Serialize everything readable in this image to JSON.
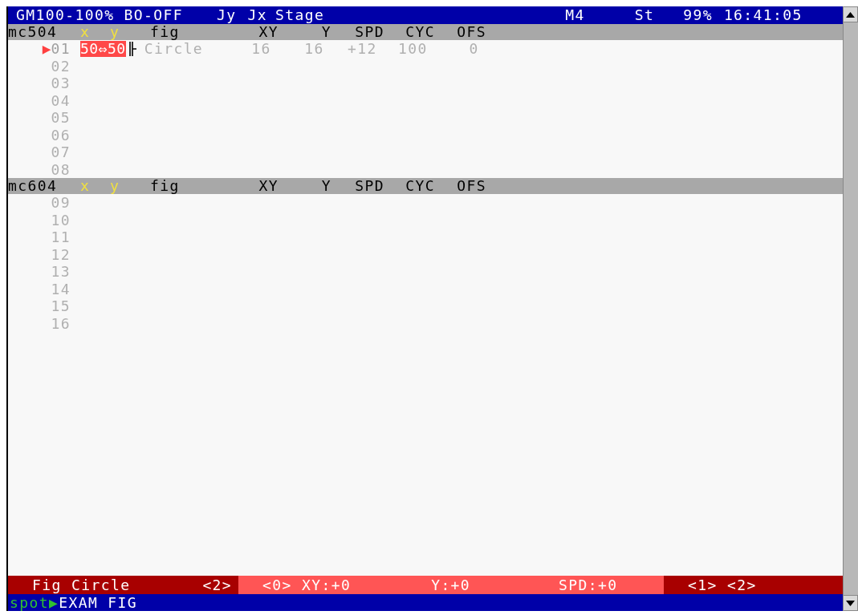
{
  "title_bar": {
    "items": [
      "GM100-100% BO-OFF",
      "Jy",
      "Jx",
      "Stage",
      "M4",
      "St",
      "99%",
      "16:41:05"
    ]
  },
  "panels": [
    {
      "name": "mc504",
      "columns": [
        {
          "label": "x",
          "kind": "coordinate"
        },
        {
          "label": "y",
          "kind": "coordinate"
        },
        {
          "label": "fig",
          "kind": "field"
        },
        {
          "label": "XY",
          "kind": "field"
        },
        {
          "label": "Y",
          "kind": "field"
        },
        {
          "label": "SPD",
          "kind": "field"
        },
        {
          "label": "CYC",
          "kind": "field"
        },
        {
          "label": "OFS",
          "kind": "field"
        }
      ],
      "rows": [
        {
          "number": "01",
          "selected": true,
          "marker": "▶",
          "value": "50⇔50",
          "fig": "Circle",
          "cells": [
            "16",
            "16",
            "+12",
            "100",
            "0"
          ]
        },
        {
          "number": "02",
          "selected": false
        },
        {
          "number": "03",
          "selected": false
        },
        {
          "number": "04",
          "selected": false
        },
        {
          "number": "05",
          "selected": false
        },
        {
          "number": "06",
          "selected": false
        },
        {
          "number": "07",
          "selected": false
        },
        {
          "number": "08",
          "selected": false
        }
      ]
    },
    {
      "name": "mc604",
      "columns": [
        {
          "label": "x",
          "kind": "coordinate"
        },
        {
          "label": "y",
          "kind": "coordinate"
        },
        {
          "label": "fig",
          "kind": "field"
        },
        {
          "label": "XY",
          "kind": "field"
        },
        {
          "label": "Y",
          "kind": "field"
        },
        {
          "label": "SPD",
          "kind": "field"
        },
        {
          "label": "CYC",
          "kind": "field"
        },
        {
          "label": "OFS",
          "kind": "field"
        }
      ],
      "rows": [
        {
          "number": "09",
          "selected": false
        },
        {
          "number": "10",
          "selected": false
        },
        {
          "number": "11",
          "selected": false
        },
        {
          "number": "12",
          "selected": false
        },
        {
          "number": "13",
          "selected": false
        },
        {
          "number": "14",
          "selected": false
        },
        {
          "number": "15",
          "selected": false
        },
        {
          "number": "16",
          "selected": false
        }
      ]
    }
  ],
  "status_bar": {
    "segments": [
      {
        "color": "#a80000",
        "texts": [
          "Fig Circle",
          "<2>"
        ]
      },
      {
        "color": "#ff5555",
        "texts": [
          "<0> XY:+0",
          "Y:+0",
          "SPD:+0"
        ]
      },
      {
        "color": "#a80000",
        "texts": [
          "<1> <2>"
        ]
      }
    ]
  },
  "command_line": {
    "prompt": "spot▶",
    "command": "EXAM FIG"
  }
}
